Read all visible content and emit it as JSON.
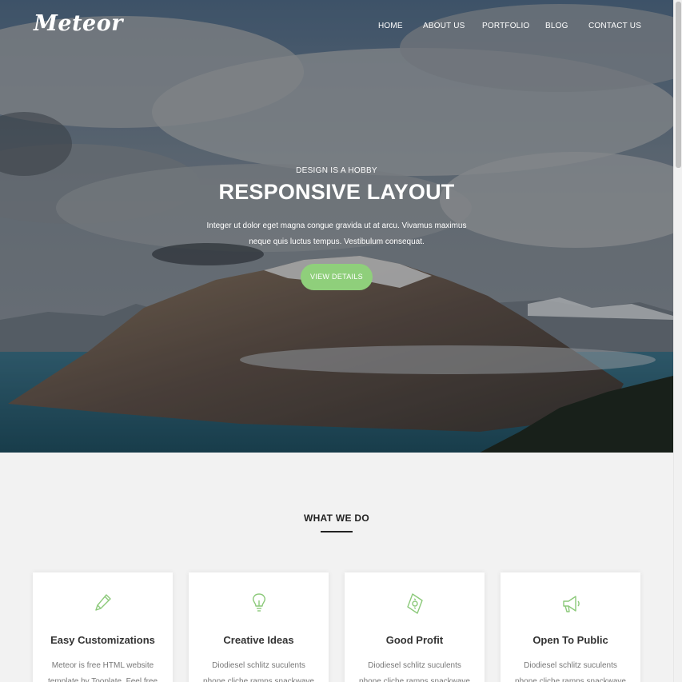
{
  "brand": {
    "logo": "Meteor"
  },
  "nav": {
    "items": [
      {
        "label": "HOME"
      },
      {
        "label": "ABOUT US"
      },
      {
        "label": "PORTFOLIO"
      },
      {
        "label": "BLOG"
      },
      {
        "label": "CONTACT US"
      }
    ]
  },
  "hero": {
    "eyebrow": "DESIGN IS A HOBBY",
    "headline": "RESPONSIVE LAYOUT",
    "lead": "Integer ut dolor eget magna congue gravida ut at arcu. Vivamus maximus neque quis luctus tempus. Vestibulum consequat.",
    "cta_label": "VIEW DETAILS"
  },
  "services": {
    "title": "WHAT WE DO",
    "cards": [
      {
        "icon": "pencil-icon",
        "title": "Easy Customizations",
        "text": "Meteor is free HTML website template by Tooplate. Feel free to"
      },
      {
        "icon": "lightbulb-icon",
        "title": "Creative Ideas",
        "text": "Diodiesel schlitz suculents phone cliche ramps snackwave coloring"
      },
      {
        "icon": "money-icon",
        "title": "Good Profit",
        "text": "Diodiesel schlitz suculents phone cliche ramps snackwave coloring"
      },
      {
        "icon": "megaphone-icon",
        "title": "Open To Public",
        "text": "Diodiesel schlitz suculents phone cliche ramps snackwave coloring"
      }
    ]
  },
  "colors": {
    "accent": "#8fcf7b",
    "icon_stroke": "#8cc97a",
    "page_bg": "#f2f2f2"
  }
}
